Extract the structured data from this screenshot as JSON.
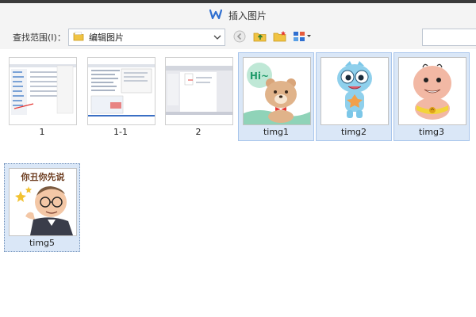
{
  "window": {
    "title": "插入图片"
  },
  "toolbar": {
    "look_in_label": "查找范围(I)：",
    "location_value": "编辑图片",
    "search_placeholder": ""
  },
  "files": [
    {
      "name": "1",
      "kind": "screenshot",
      "selected": false
    },
    {
      "name": "1-1",
      "kind": "screenshot",
      "selected": false
    },
    {
      "name": "2",
      "kind": "screenshot",
      "selected": false
    },
    {
      "name": "timg1",
      "kind": "cartoon-bear",
      "selected": true,
      "badge_text": "Hi~"
    },
    {
      "name": "timg2",
      "kind": "cartoon-blue-creature",
      "selected": true
    },
    {
      "name": "timg3",
      "kind": "cartoon-bald-man",
      "selected": true
    },
    {
      "name": "timg5",
      "kind": "cartoon-old-man",
      "selected": true,
      "focused": true,
      "caption": "你丑你先说"
    }
  ],
  "colors": {
    "selection_bg": "#dae7f7",
    "selection_border": "#a9c6ec",
    "accent_blue": "#2f6fd0"
  }
}
